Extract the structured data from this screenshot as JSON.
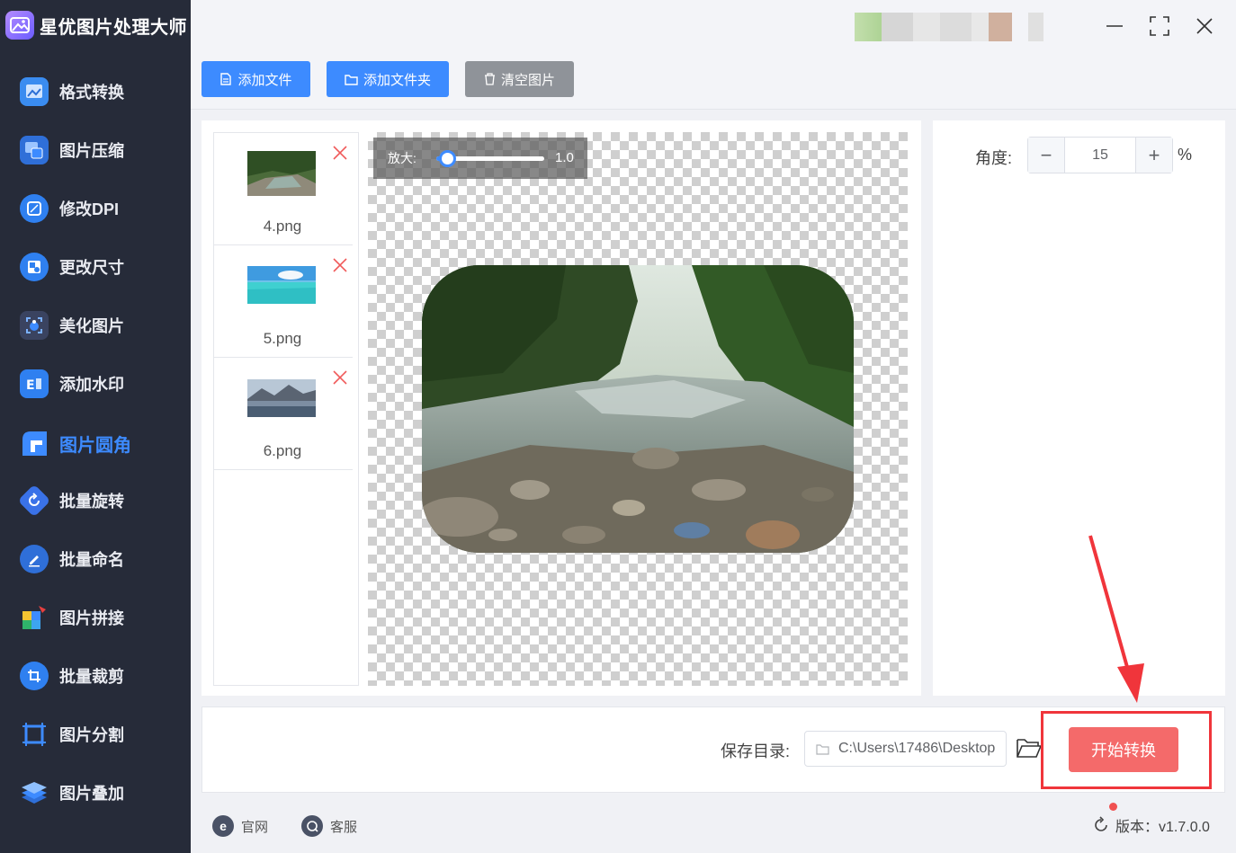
{
  "app": {
    "title": "星优图片处理大师"
  },
  "sidebar": {
    "items": [
      {
        "label": "格式转换",
        "icon": "image-convert-icon",
        "active": false
      },
      {
        "label": "图片压缩",
        "icon": "image-compress-icon",
        "active": false
      },
      {
        "label": "修改DPI",
        "icon": "dpi-icon",
        "active": false
      },
      {
        "label": "更改尺寸",
        "icon": "resize-icon",
        "active": false
      },
      {
        "label": "美化图片",
        "icon": "beautify-icon",
        "active": false
      },
      {
        "label": "添加水印",
        "icon": "watermark-icon",
        "active": false
      },
      {
        "label": "图片圆角",
        "icon": "rounded-corner-icon",
        "active": true
      },
      {
        "label": "批量旋转",
        "icon": "rotate-icon",
        "active": false
      },
      {
        "label": "批量命名",
        "icon": "rename-icon",
        "active": false
      },
      {
        "label": "图片拼接",
        "icon": "puzzle-icon",
        "active": false
      },
      {
        "label": "批量裁剪",
        "icon": "crop-icon",
        "active": false
      },
      {
        "label": "图片分割",
        "icon": "split-icon",
        "active": false
      },
      {
        "label": "图片叠加",
        "icon": "layers-icon",
        "active": false
      }
    ]
  },
  "toolbar": {
    "add_file": "添加文件",
    "add_folder": "添加文件夹",
    "clear_images": "清空图片"
  },
  "files": [
    {
      "name": "4.png",
      "thumb": "forest-river"
    },
    {
      "name": "5.png",
      "thumb": "tropical-sea"
    },
    {
      "name": "6.png",
      "thumb": "mountain-lake"
    }
  ],
  "zoom": {
    "label": "放大:",
    "value": "1.0",
    "level": 0.1
  },
  "angle": {
    "label": "角度:",
    "value": "15",
    "unit": "%",
    "minus": "−",
    "plus": "+"
  },
  "save": {
    "label": "保存目录:",
    "path": "C:\\Users\\17486\\Desktop"
  },
  "start_button": "开始转换",
  "footer": {
    "website": "官网",
    "support": "客服",
    "version": "版本：v1.7.0.0"
  },
  "colors": {
    "sidebar_bg": "#262b39",
    "primary": "#3d8bff",
    "danger": "#f46a6a",
    "highlight": "#f0353b",
    "gray_button": "#8f9399"
  }
}
